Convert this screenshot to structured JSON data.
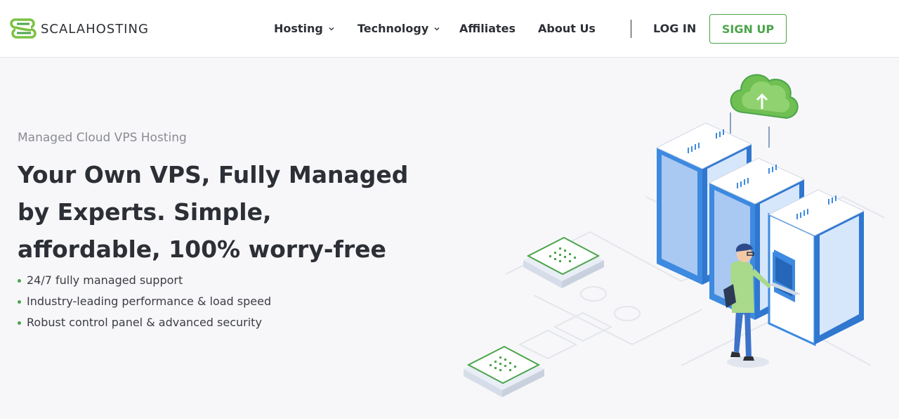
{
  "brand": {
    "name": "SCALAHOSTING",
    "accent": "#4ba54b"
  },
  "nav": {
    "items": [
      {
        "label": "Hosting",
        "has_dropdown": true
      },
      {
        "label": "Technology",
        "has_dropdown": true
      },
      {
        "label": "Affiliates",
        "has_dropdown": false
      },
      {
        "label": "About Us",
        "has_dropdown": false
      }
    ],
    "login_label": "LOG IN",
    "signup_label": "SIGN UP"
  },
  "hero": {
    "subtitle": "Managed Cloud VPS Hosting",
    "title": "Your Own VPS, Fully Managed by Experts. Simple, affordable, 100% worry-free",
    "features": [
      "24/7 fully managed support",
      "Industry-leading performance & load speed",
      "Robust control panel & advanced security"
    ]
  },
  "icons": [
    "logo-mark-icon",
    "chevron-down-icon",
    "cloud-upload-icon",
    "server-rack-icon",
    "chip-icon"
  ]
}
